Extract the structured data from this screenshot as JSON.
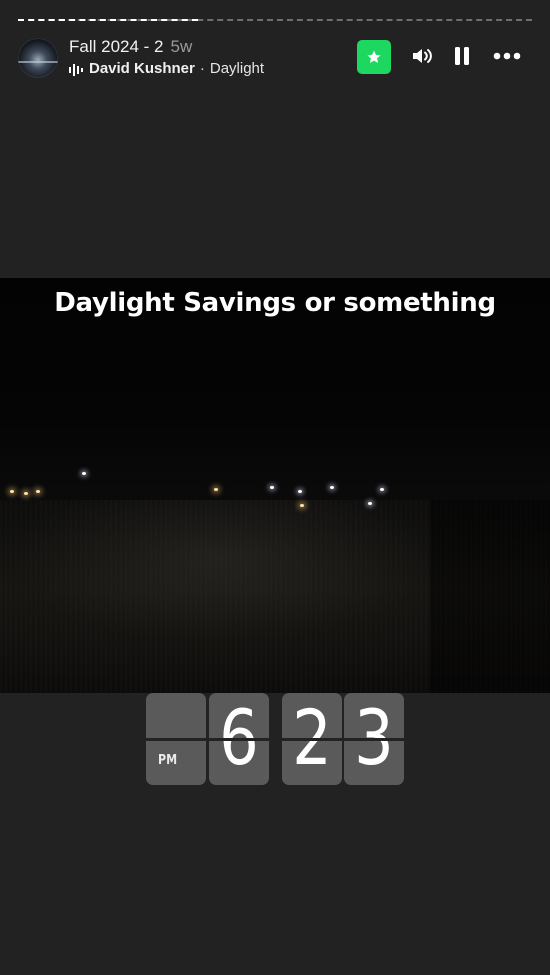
{
  "story": {
    "progress": 0.35
  },
  "header": {
    "title": "Fall 2024 - 2",
    "time_ago": "5w",
    "artist": "David Kushner",
    "separator": "·",
    "song": "Daylight"
  },
  "controls": {
    "favorite_icon": "star-icon",
    "volume_icon": "volume-icon",
    "pause_icon": "pause-icon",
    "more_icon": "more-icon"
  },
  "caption": {
    "text": "Daylight Savings or something"
  },
  "clock": {
    "ampm": "PM",
    "hour": "6",
    "minute_tens": "2",
    "minute_ones": "3"
  },
  "colors": {
    "background": "#222222",
    "accent_green": "#1ed760",
    "flip_card": "#5a5a5a"
  }
}
